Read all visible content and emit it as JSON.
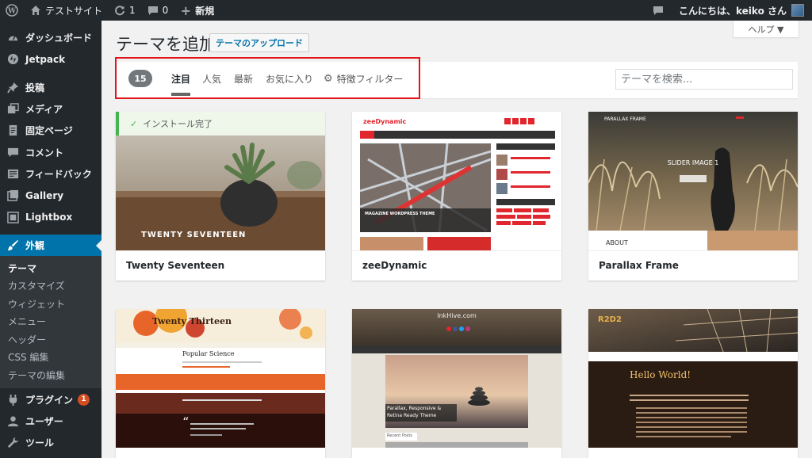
{
  "adminbar": {
    "site_name": "テストサイト",
    "updates_count": "1",
    "comments_count": "0",
    "new_label": "新規",
    "greeting": "こんにちは、keiko さん"
  },
  "sidebar": {
    "items": [
      {
        "label": "ダッシュボード",
        "icon": "dashboard-icon"
      },
      {
        "label": "Jetpack",
        "icon": "jetpack-icon"
      },
      {
        "label": "投稿",
        "icon": "pin-icon"
      },
      {
        "label": "メディア",
        "icon": "media-icon"
      },
      {
        "label": "固定ページ",
        "icon": "page-icon"
      },
      {
        "label": "コメント",
        "icon": "comment-icon"
      },
      {
        "label": "フィードバック",
        "icon": "feedback-icon"
      },
      {
        "label": "Gallery",
        "icon": "gallery-icon"
      },
      {
        "label": "Lightbox",
        "icon": "lightbox-icon"
      },
      {
        "label": "外観",
        "icon": "brush-icon"
      },
      {
        "label": "プラグイン",
        "icon": "plugin-icon",
        "badge": "1"
      },
      {
        "label": "ユーザー",
        "icon": "user-icon"
      },
      {
        "label": "ツール",
        "icon": "wrench-icon"
      }
    ],
    "submenu": [
      "テーマ",
      "カスタマイズ",
      "ウィジェット",
      "メニュー",
      "ヘッダー",
      "CSS 編集",
      "テーマの編集"
    ]
  },
  "main": {
    "help_label": "ヘルプ ▼",
    "page_title": "テーマを追加",
    "upload_label": "テーマのアップロード",
    "theme_count": "15",
    "tabs": [
      "注目",
      "人気",
      "最新",
      "お気に入り"
    ],
    "feature_filter_label": "特徴フィルター",
    "search_placeholder": "テーマを検索...",
    "installed_label": "インストール完了"
  },
  "themes": [
    {
      "name": "Twenty Seventeen",
      "shot_title": "TWENTY SEVENTEEN"
    },
    {
      "name": "zeeDynamic",
      "shot_title": "zeeDynamic",
      "shot_caption": "MAGAZINE WORDPRESS THEME"
    },
    {
      "name": "Parallax Frame",
      "shot_title": "PARALLAX FRAME",
      "shot_caption": "SLIDER IMAGE 1",
      "shot_section": "ABOUT"
    },
    {
      "shot_title": "Twenty Thirteen",
      "shot_heading": "Popular Science"
    },
    {
      "shot_title": "InkHive.com",
      "shot_caption": "Parallax, Responsive & Retina Ready Theme",
      "shot_section": "Recent Posts"
    },
    {
      "shot_title": "R2D2",
      "shot_heading": "Hello World!"
    }
  ],
  "colors": {
    "adminbar_bg": "#23282d",
    "menu_current": "#0073aa",
    "highlight_border": "#e2151b",
    "installed_green": "#46b450"
  }
}
